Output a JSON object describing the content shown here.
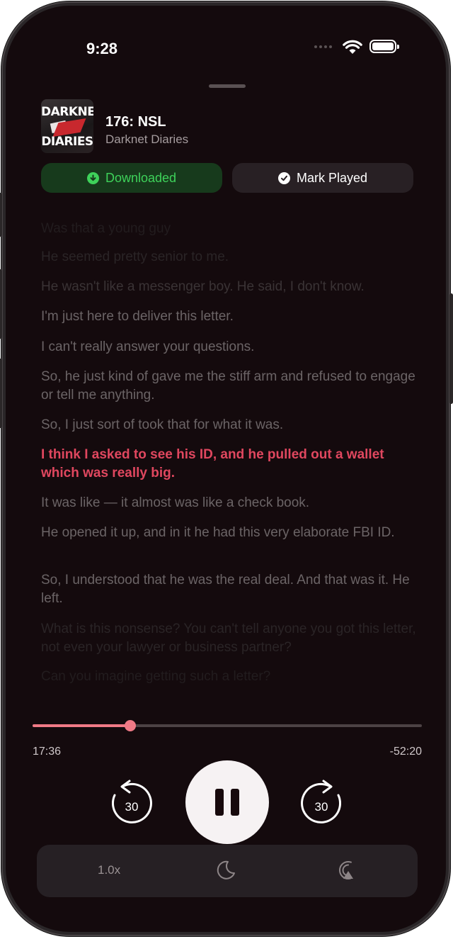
{
  "status_bar": {
    "time": "9:28",
    "icons": [
      "wifi-icon",
      "battery-icon"
    ]
  },
  "episode": {
    "title": "176: NSL",
    "show": "Darknet Diaries",
    "artwork_text_top": "DARKNET",
    "artwork_text_bottom": "DIARIES"
  },
  "actions": {
    "downloaded_label": "Downloaded",
    "mark_played_label": "Mark Played"
  },
  "transcript": {
    "lines": [
      {
        "text": "Was that a young guy",
        "state": "fade3"
      },
      {
        "text": "He seemed pretty senior to me.",
        "state": "fade2"
      },
      {
        "text": "He wasn't like a messenger boy. He said, I don't know.",
        "state": "fade1"
      },
      {
        "text": "I'm just here to deliver this letter.",
        "state": "normal"
      },
      {
        "text": "I can't really answer your questions.",
        "state": "normal"
      },
      {
        "text": "So, he just kind of gave me the stiff arm and refused to engage or tell me anything.",
        "state": "normal"
      },
      {
        "text": "So, I just sort of took that for what it was.",
        "state": "normal"
      },
      {
        "text": "I think I asked to see his ID, and he pulled out a wallet which was really big.",
        "state": "current"
      },
      {
        "text": "It was like — it almost was like a check book.",
        "state": "normal"
      },
      {
        "text": "He opened it up, and in it he had this very elaborate FBI ID.",
        "state": "normal"
      },
      {
        "text": "So, I understood that he was the real deal. And that was it. He left.",
        "state": "normal"
      },
      {
        "text": "What is this nonsense? You can't tell anyone you got this letter, not even your lawyer or business partner?",
        "state": "fade2"
      },
      {
        "text": "Can you imagine getting such a letter?",
        "state": "fade3"
      }
    ]
  },
  "player": {
    "elapsed": "17:36",
    "remaining": "-52:20",
    "progress_fraction": 0.25,
    "skip_back_seconds": "30",
    "skip_forward_seconds": "30",
    "state": "playing"
  },
  "bottom_bar": {
    "speed_label": "1.0x",
    "icons": [
      "moon-icon",
      "airplay-icon"
    ]
  },
  "colors": {
    "background": "#140a0d",
    "accent": "#f07a86",
    "current_line": "#e0475f",
    "downloaded_green": "#3ed25a"
  }
}
